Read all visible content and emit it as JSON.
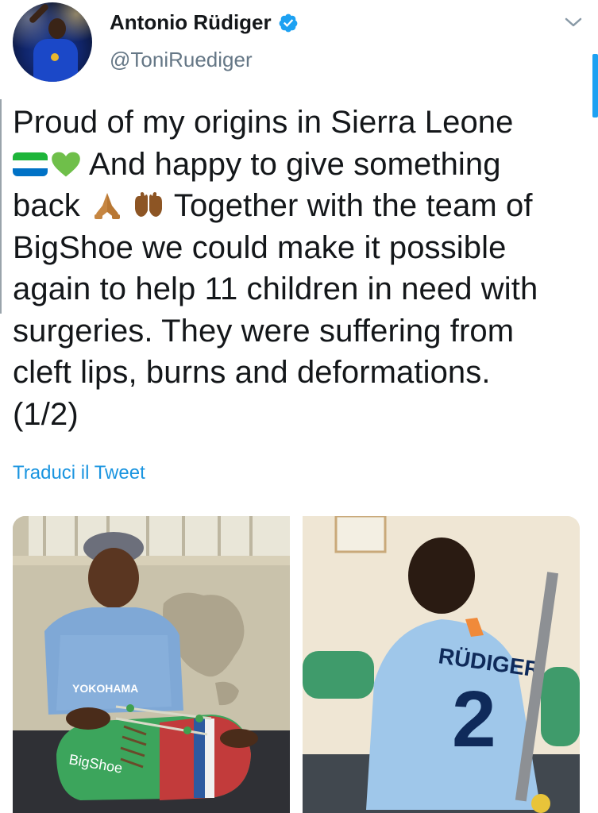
{
  "tweet": {
    "author_name": "Antonio Rüdiger",
    "author_handle": "@ToniRuediger",
    "text_lines": [
      "Proud of my origins in Sierra Leone",
      "And happy to give something",
      "back",
      "Together with the team of",
      "BigShoe we could make it possible",
      "again to help 11 children in need with",
      "surgeries. They were suffering from",
      "cleft lips, burns and deformations.",
      "(1/2)"
    ],
    "translate_link": "Traduci il Tweet",
    "photos": [
      {
        "label": "YOKOHAMA",
        "shoe_text": "BigShoe"
      },
      {
        "jersey_name": "RÜDIGER",
        "jersey_number": "2"
      }
    ]
  },
  "colors": {
    "verified_blue": "#1da1f2",
    "link_blue": "#1b95e0",
    "handle_gray": "#657786",
    "flag_green": "#1eb53a",
    "flag_white": "#ffffff",
    "flag_blue": "#0072c6",
    "heart_green": "#6fbf4a",
    "hands_brown": "#c68642",
    "hands_dark": "#8d5524"
  },
  "icons": [
    "verified-badge-icon",
    "chevron-down-icon",
    "sierra-leone-flag-icon",
    "green-heart-icon",
    "folded-hands-icon",
    "raised-hands-icon"
  ]
}
